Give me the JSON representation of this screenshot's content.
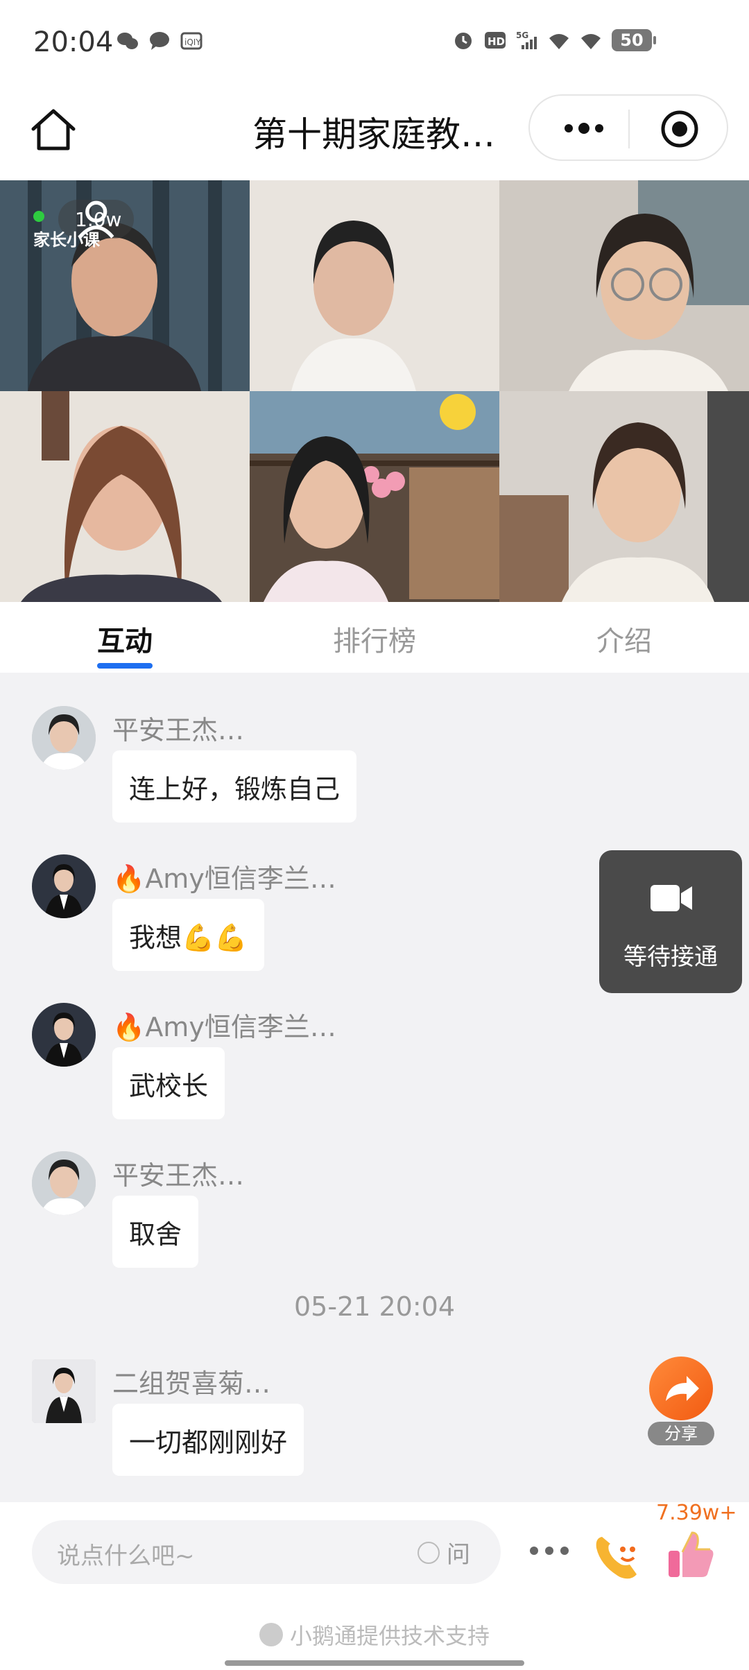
{
  "status_bar": {
    "time": "20:04",
    "battery": "50",
    "icons_left": [
      "wechat-icon",
      "chat-bubble-icon",
      "iqiyi-icon"
    ],
    "icons_right": [
      "alarm-icon",
      "hd-icon",
      "5g-signal-icon",
      "wifi-icon",
      "wifi-icon"
    ]
  },
  "nav": {
    "title": "第十期家庭教…"
  },
  "live": {
    "viewer_count": "1.0w",
    "brand": "家长小课"
  },
  "tabs": [
    {
      "label": "互动",
      "active": true
    },
    {
      "label": "排行榜",
      "active": false
    },
    {
      "label": "介绍",
      "active": false
    }
  ],
  "messages": [
    {
      "user": "平安王杰…",
      "text": "连上好，锻炼自己"
    },
    {
      "user": "🔥Amy恒信李兰…",
      "text": "我想💪💪"
    },
    {
      "user": "🔥Amy恒信李兰…",
      "text": "武校长"
    },
    {
      "user": "平安王杰…",
      "text": "取舍"
    },
    {
      "user": "二组贺喜菊…",
      "text": "一切都刚刚好"
    }
  ],
  "timestamp": "05-21 20:04",
  "wait_card": {
    "label": "等待接通"
  },
  "share": {
    "label": "分享"
  },
  "bottom": {
    "input_placeholder": "说点什么吧~",
    "question_label": "问",
    "like_count": "7.39w+",
    "powered_by": "小鹅通提供技术支持"
  },
  "colors": {
    "accent": "#1e6ff0",
    "share": "#f25b12",
    "like": "#f07020"
  }
}
